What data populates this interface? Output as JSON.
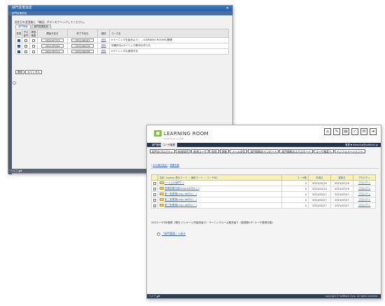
{
  "dialog": {
    "title": "部門変更設定",
    "subtitle": "部門変更設定",
    "instruction": "設定日を変更後に「確認」ボタンをクリックしてください。",
    "tabs": [
      "部門情報",
      "部門変更設定"
    ],
    "columns": [
      "変更",
      "子の部門",
      "移動権限",
      "開始予定日",
      "終了予定日",
      "種別",
      "コース名"
    ],
    "rows": [
      {
        "change": true,
        "child": false,
        "move": false,
        "start": "2021/07/21",
        "end": "2021/08/01",
        "type": "資料",
        "course": "eラーニングを始めよう！ - LEARNING ROOMの基礎 -"
      },
      {
        "change": true,
        "child": false,
        "move": false,
        "start": "2021/09/02",
        "end": "2021/08/16",
        "type": "資料",
        "course": "効果的なeラーニング教材の作り方"
      },
      {
        "change": true,
        "child": false,
        "move": false,
        "start": "2021/09/11",
        "end": "2021/08/28",
        "type": "資料",
        "course": "eラーニングの運用方法"
      }
    ],
    "buttons": [
      "確認",
      "キャンセル"
    ],
    "status": "ヘルプ ▲▼"
  },
  "app": {
    "logo_text": "LEARNING ROOM",
    "logo_sub": "powered by e-portal",
    "header_icons": [
      "ホーム",
      "マイページ",
      "管理",
      "設定",
      "お知らせ",
      "ログアウト"
    ],
    "nav_tabs": [
      "部門管理",
      "ユーザ管理"
    ],
    "user_info": "管理 ▼ elearning@softbank.jp",
    "toolbar": [
      "部門のプロパティ",
      "新規部門",
      "新規ユーザ",
      "削除",
      "移動",
      "メール送信",
      "部門情報のインポート",
      "部門情報のエクスポート",
      "ユーザ検索へ",
      "インフォメーションへ"
    ],
    "breadcrumb_root": "SOO株式会社",
    "breadcrumb_current": "営業本部",
    "columns": [
      "",
      "名前（lookup 表示コード ／ 識別コード ／ ユーザID）",
      "ユーザ数",
      "作成日",
      "更新日",
      "プロパティ"
    ],
    "rows": [
      {
        "name": "(一つ上の部門へ)",
        "users": "0",
        "created": "2021/02/15",
        "updated": "2021/07/15",
        "prop": "プロパティ"
      },
      {
        "name": "営業部第四部(mqu.de004 / -)",
        "users": "0",
        "created": "2021/02/15",
        "updated": "2021/07/15",
        "prop": "プロパティ"
      },
      {
        "name": "第一営業課(mqu.de004 / -)",
        "users": "0",
        "created": "2021/02/27",
        "updated": "2021/07/27",
        "prop": "プロパティ"
      },
      {
        "name": "第二営業課(mqu.de004 / -)",
        "users": "0",
        "created": "2021/02/27",
        "updated": "2021/07/27",
        "prop": "プロパティ"
      },
      {
        "name": "第三営業課(mqu.de004 / -)",
        "users": "0",
        "created": "2021/02/27",
        "updated": "2021/07/27",
        "prop": "プロパティ"
      }
    ],
    "summary": "205ユーザ中8登録（現在 パッケージ内保持者２）ラーニングルーム販売者２（登録数197 ユーザ登録可能）",
    "bottom_link": "「部門管理」へ戻る",
    "status_left": "ヘルプ ▲▼",
    "status_right": "Copyright © SoftBank Corp. All rights reserved."
  }
}
